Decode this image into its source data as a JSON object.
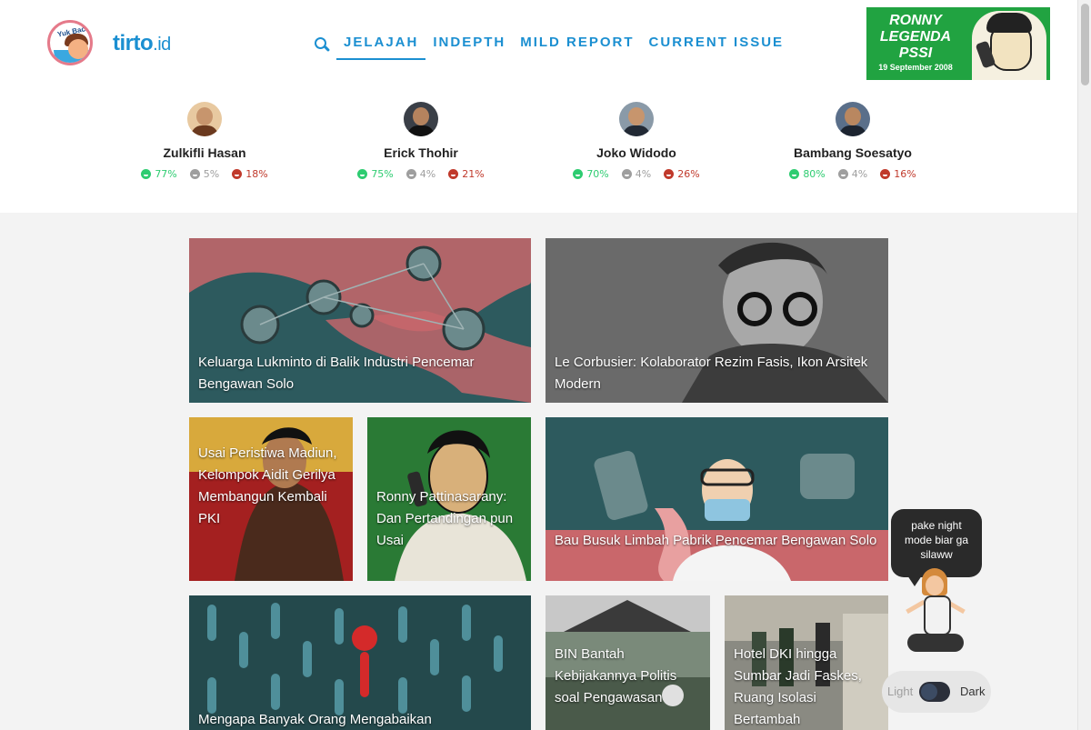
{
  "brand": {
    "logo_badge_text": "Yuk Baca",
    "name_main": "tirto",
    "name_suffix": ".id"
  },
  "nav": {
    "items": [
      {
        "label": "JELAJAH",
        "active": true
      },
      {
        "label": "INDEPTH",
        "active": false
      },
      {
        "label": "MILD REPORT",
        "active": false
      },
      {
        "label": "CURRENT ISSUE",
        "active": false
      }
    ]
  },
  "ad": {
    "line1": "RONNY",
    "line2": "LEGENDA",
    "line3": "PSSI",
    "date": "19 September 2008"
  },
  "people": [
    {
      "name": "Zulkifli Hasan",
      "positive": "77%",
      "neutral": "5%",
      "negative": "18%"
    },
    {
      "name": "Erick Thohir",
      "positive": "75%",
      "neutral": "4%",
      "negative": "21%"
    },
    {
      "name": "Joko Widodo",
      "positive": "70%",
      "neutral": "4%",
      "negative": "26%"
    },
    {
      "name": "Bambang Soesatyo",
      "positive": "80%",
      "neutral": "4%",
      "negative": "16%"
    }
  ],
  "articles": [
    {
      "title": "Keluarga Lukminto di Balik Industri Pencemar Bengawan Solo"
    },
    {
      "title": "Le Corbusier: Kolaborator Rezim Fasis, Ikon Arsitek Modern"
    },
    {
      "title": "Usai Peristiwa Madiun, Kelompok Aidit Gerilya Membangun Kembali PKI"
    },
    {
      "title": "Ronny Pattinasarany: Dan Pertandingan pun Usai"
    },
    {
      "title": "Bau Busuk Limbah Pabrik Pencemar Bengawan Solo"
    },
    {
      "title": "Mengapa Banyak Orang Mengabaikan"
    },
    {
      "title": "BIN Bantah Kebijakannya Politis soal Pengawasan"
    },
    {
      "title": "Hotel DKI hingga Sumbar Jadi Faskes, Ruang Isolasi Bertambah"
    }
  ],
  "theme_widget": {
    "bubble_text": "pake night mode biar ga silaww",
    "light_label": "Light",
    "dark_label": "Dark"
  },
  "colors": {
    "brand_blue": "#1b8fd1",
    "positive": "#2ecc71",
    "neutral": "#9e9e9e",
    "negative": "#c0392b",
    "ad_green": "#21a341"
  }
}
